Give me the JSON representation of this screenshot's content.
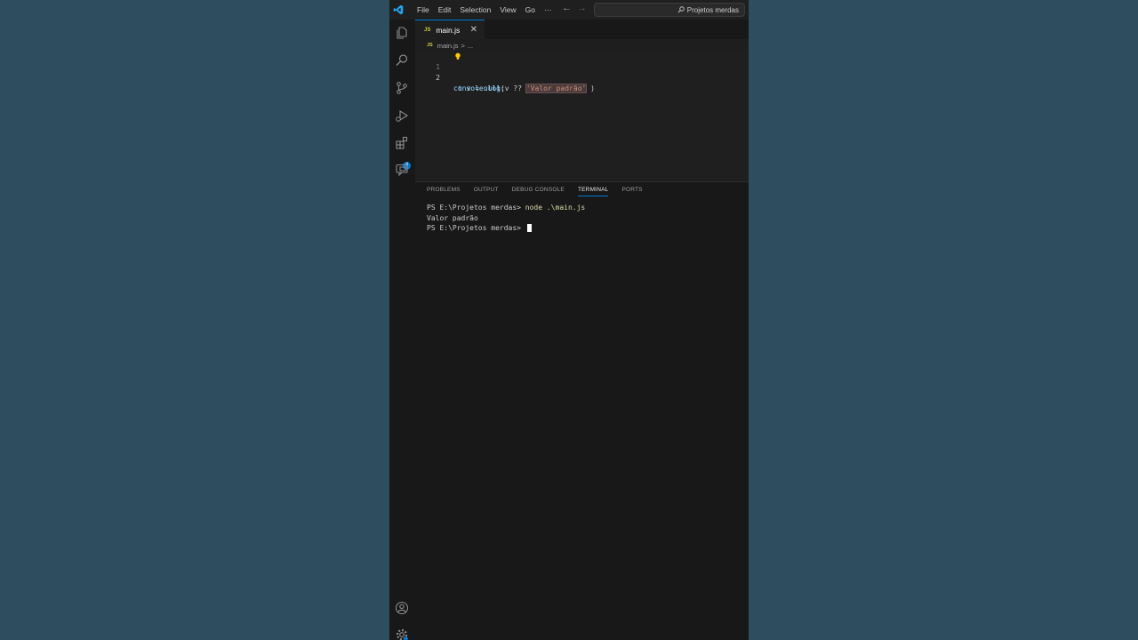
{
  "menu": [
    "File",
    "Edit",
    "Selection",
    "View",
    "Go",
    "···"
  ],
  "command_center": {
    "label": "Projetos merdas"
  },
  "tab": {
    "label": "main.js",
    "lang_badge": "JS"
  },
  "breadcrumb": {
    "file": "main.js",
    "separator": ">",
    "more": "..."
  },
  "editor": {
    "line1": {
      "num": "1",
      "kw": "t",
      "rest": " v = null;"
    },
    "line2": {
      "num": "2",
      "fn": "console.log",
      "open": "(v ?? ",
      "str": "'Valor padrão'",
      "close": " )"
    }
  },
  "activity_badge": "4",
  "panel": {
    "tabs": [
      "PROBLEMS",
      "OUTPUT",
      "DEBUG CONSOLE",
      "TERMINAL",
      "PORTS"
    ],
    "active_tab": "TERMINAL"
  },
  "terminal": {
    "prompt": "PS E:\\Projetos merdas> ",
    "command": "node .\\main.js",
    "output": "Valor padrão",
    "prompt2": "PS E:\\Projetos merdas> "
  },
  "colors": {
    "accent": "#0078d4",
    "background": "#2e4d5f",
    "editor_bg": "#1f1f1f"
  }
}
